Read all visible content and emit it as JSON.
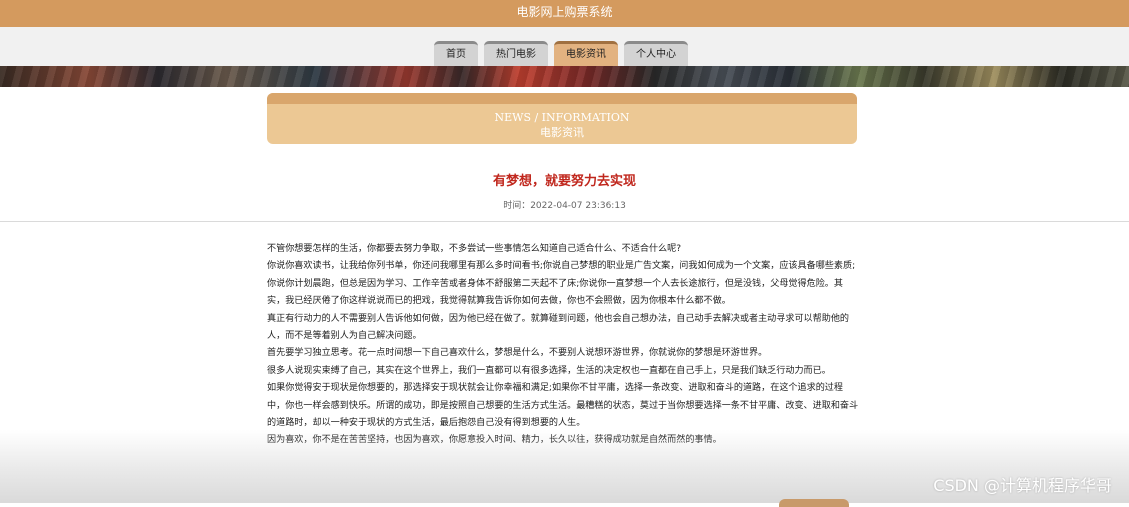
{
  "header": {
    "site_title": "电影网上购票系统"
  },
  "nav": {
    "items": [
      {
        "label": "首页"
      },
      {
        "label": "热门电影"
      },
      {
        "label": "电影资讯"
      },
      {
        "label": "个人中心"
      }
    ],
    "active_index": 2
  },
  "section": {
    "title_en": "NEWS / INFORMATION",
    "title_cn": "电影资讯"
  },
  "article": {
    "title": "有梦想，就要努力去实现",
    "time": "时间：2022-04-07 23:36:13",
    "paragraphs": [
      "不管你想要怎样的生活，你都要去努力争取，不多尝试一些事情怎么知道自己适合什么、不适合什么呢?",
      "你说你喜欢读书，让我给你列书单，你还问我哪里有那么多时间看书;你说自己梦想的职业是广告文案，问我如何成为一个文案，应该具备哪些素质;你说你计划晨跑，但总是因为学习、工作辛苦或者身体不舒服第二天起不了床;你说你一直梦想一个人去长途旅行，但是没钱，父母觉得危险。其实，我已经厌倦了你这样说说而已的把戏，我觉得就算我告诉你如何去做，你也不会照做，因为你根本什么都不做。",
      "真正有行动力的人不需要别人告诉他如何做，因为他已经在做了。就算碰到问题，他也会自己想办法，自己动手去解决或者主动寻求可以帮助他的人，而不是等着别人为自己解决问题。",
      "首先要学习独立思考。花一点时间想一下自己喜欢什么，梦想是什么，不要别人说想环游世界，你就说你的梦想是环游世界。",
      "很多人说现实束缚了自己，其实在这个世界上，我们一直都可以有很多选择，生活的决定权也一直都在自己手上，只是我们缺乏行动力而已。",
      "如果你觉得安于现状是你想要的，那选择安于现状就会让你幸福和满足;如果你不甘平庸，选择一条改变、进取和奋斗的道路，在这个追求的过程中，你也一样会感到快乐。所谓的成功，即是按照自己想要的生活方式生活。最糟糕的状态，莫过于当你想要选择一条不甘平庸、改变、进取和奋斗的道路时，却以一种安于现状的方式生活，最后抱怨自己没有得到想要的人生。",
      "因为喜欢，你不是在苦苦坚持，也因为喜欢，你愿意投入时间、精力，长久以往，获得成功就是自然而然的事情。"
    ]
  },
  "watermark": {
    "text": "CSDN @计算机程序华哥"
  },
  "colors": {
    "header_bg": "#d49a5e",
    "nav_active": "#e2b280",
    "panel_bg": "#ecc894",
    "title_red": "#c0271d"
  }
}
